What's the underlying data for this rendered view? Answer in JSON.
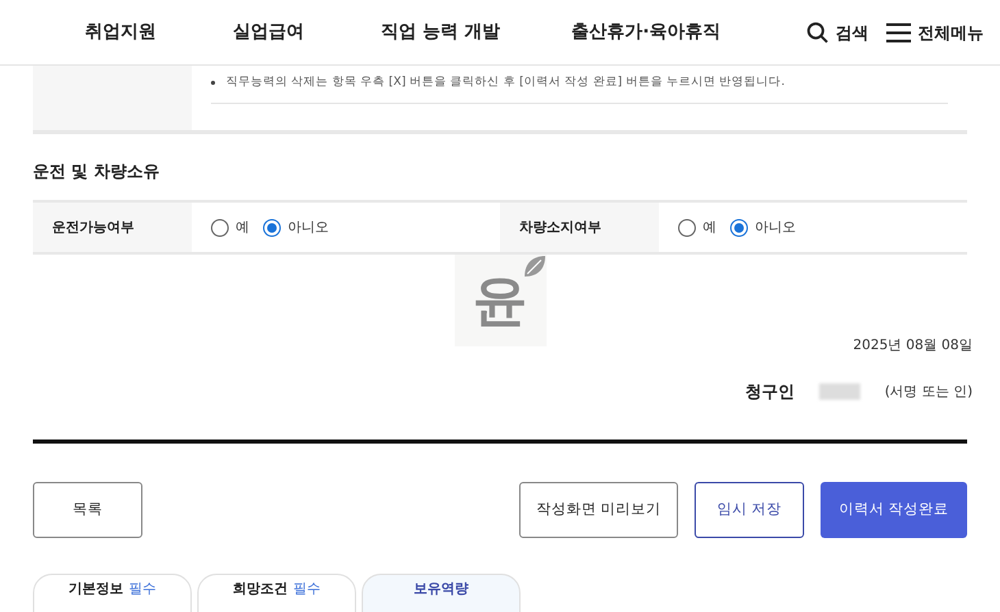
{
  "nav": {
    "items": [
      "취업지원",
      "실업급여",
      "직업 능력 개발",
      "출산휴가·육아휴직"
    ],
    "search": "검색",
    "menu": "전체메뉴"
  },
  "notice": "직무능력의 삭제는 항목 우측 [X] 버튼을 클릭하신 후 [이력서 작성 완료] 버튼을 누르시면 반영됩니다.",
  "driving": {
    "title": "운전 및 차량소유",
    "fields": [
      {
        "label": "운전가능여부",
        "options": [
          {
            "label": "예",
            "selected": false
          },
          {
            "label": "아니오",
            "selected": true
          }
        ]
      },
      {
        "label": "차량소지여부",
        "options": [
          {
            "label": "예",
            "selected": false
          },
          {
            "label": "아니오",
            "selected": true
          }
        ]
      }
    ]
  },
  "stamp": "윤",
  "date": "2025년 08월 08일",
  "claimant": {
    "label": "청구인",
    "hint": "(서명 또는 인)"
  },
  "buttons": [
    {
      "label": "목록",
      "kind": "outline"
    },
    {
      "label": "작성화면 미리보기",
      "kind": "outline"
    },
    {
      "label": "임시 저장",
      "kind": "accent"
    },
    {
      "label": "이력서 작성완료",
      "kind": "primary"
    }
  ],
  "tabs": [
    {
      "label": "기본정보",
      "tag": "필수",
      "selected": false
    },
    {
      "label": "희망조건",
      "tag": "필수",
      "selected": false
    },
    {
      "label": "보유역량",
      "selected": true
    }
  ]
}
